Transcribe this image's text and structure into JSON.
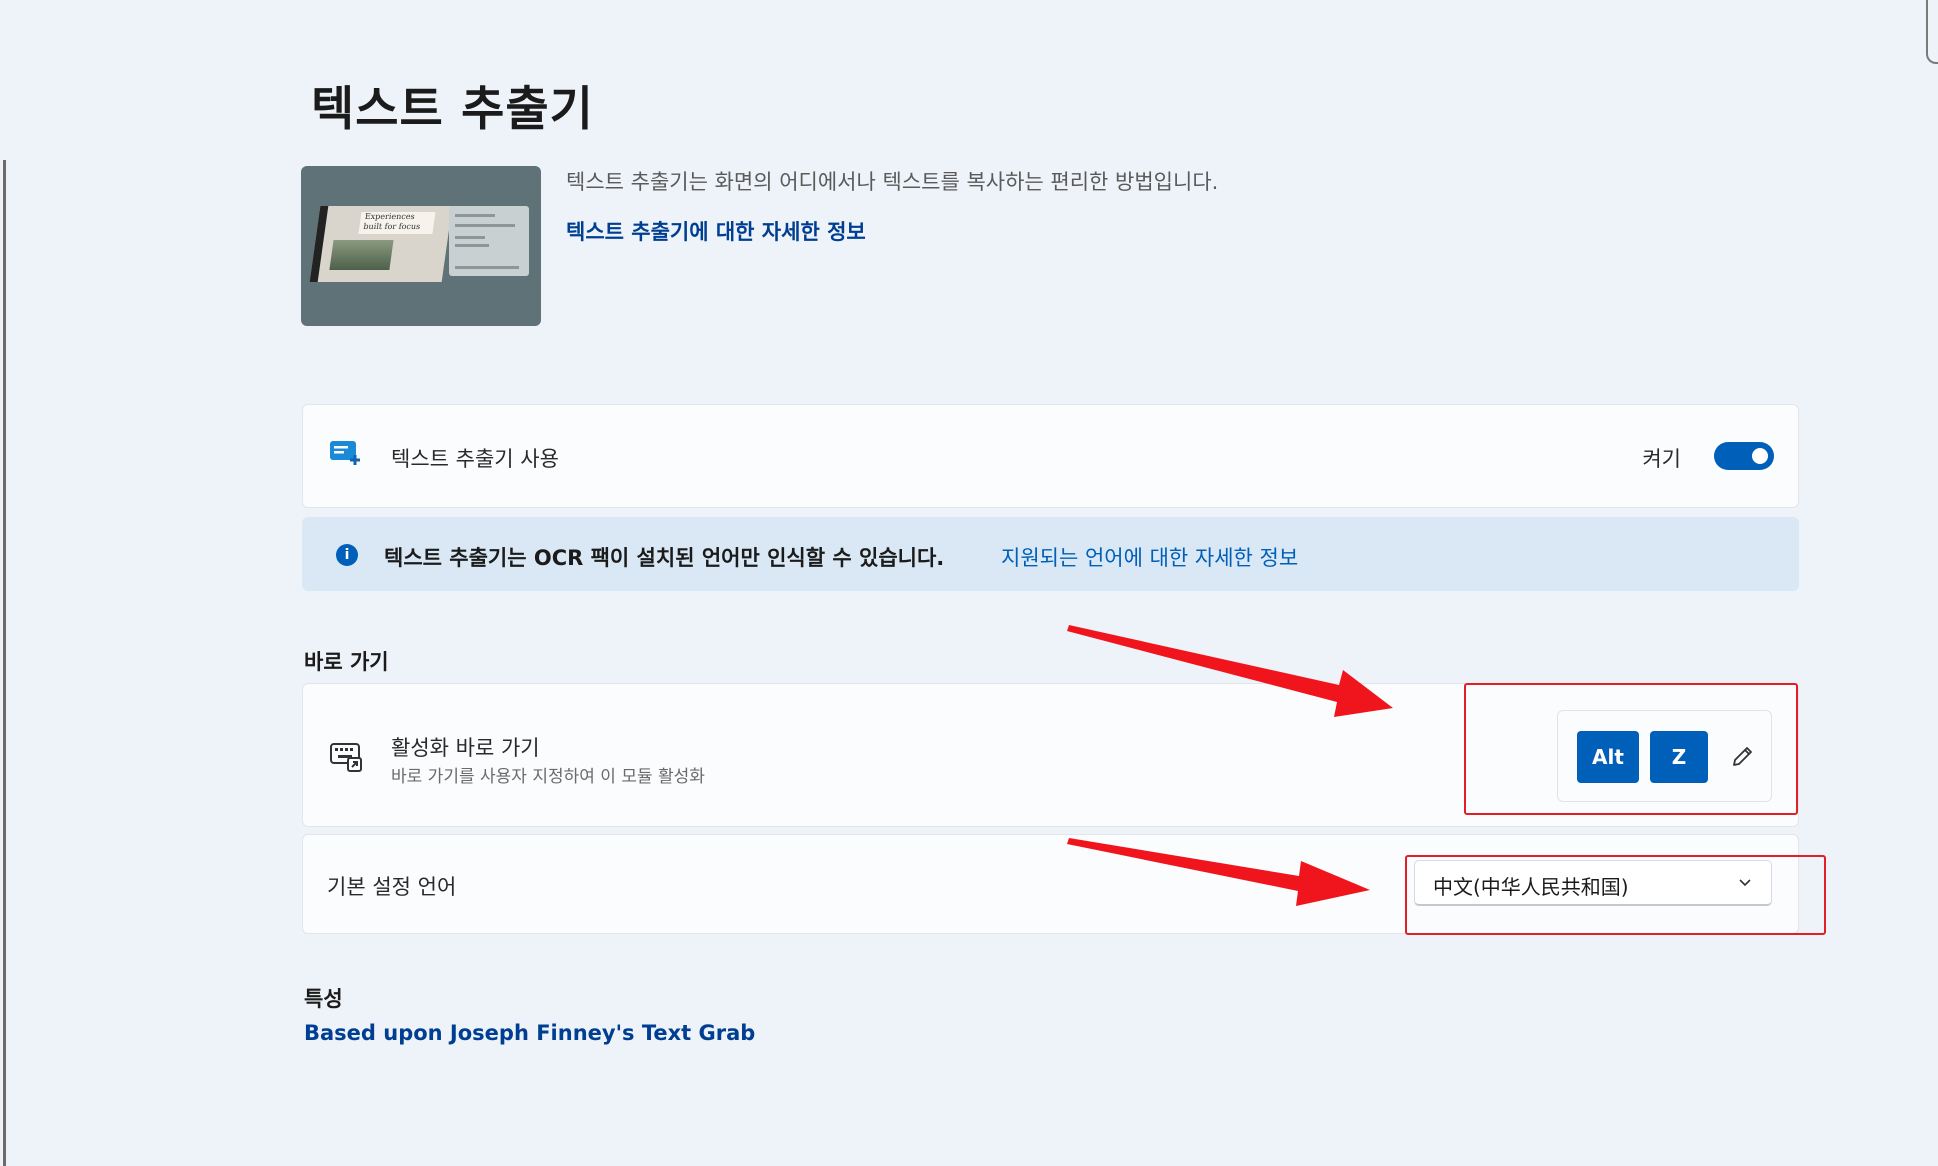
{
  "page": {
    "title": "텍스트 추출기"
  },
  "hero": {
    "description": "텍스트 추출기는 화면의 어디에서나 텍스트를 복사하는 편리한 방법입니다.",
    "link": "텍스트 추출기에 대한 자세한 정보",
    "image_caption": "Experiences built for focus"
  },
  "enable": {
    "label": "텍스트 추출기 사용",
    "toggle_state": "켜기",
    "toggle_on": true
  },
  "info": {
    "message": "텍스트 추출기는 OCR 팩이 설치된 언어만 인식할 수 있습니다.",
    "link": "지원되는 언어에 대한 자세한 정보"
  },
  "shortcuts": {
    "heading": "바로 가기",
    "activation_title": "활성화 바로 가기",
    "activation_desc": "바로 가기를 사용자 지정하여 이 모듈 활성화",
    "keys": [
      "Alt",
      "Z"
    ]
  },
  "language": {
    "label": "기본 설정 언어",
    "selected": "中文(中华人民共和国)"
  },
  "attribution": {
    "heading": "특성",
    "link": "Based upon Joseph Finney's Text Grab"
  },
  "colors": {
    "accent": "#005fb8",
    "annotation": "#e21f26",
    "background": "#eef3f9"
  }
}
